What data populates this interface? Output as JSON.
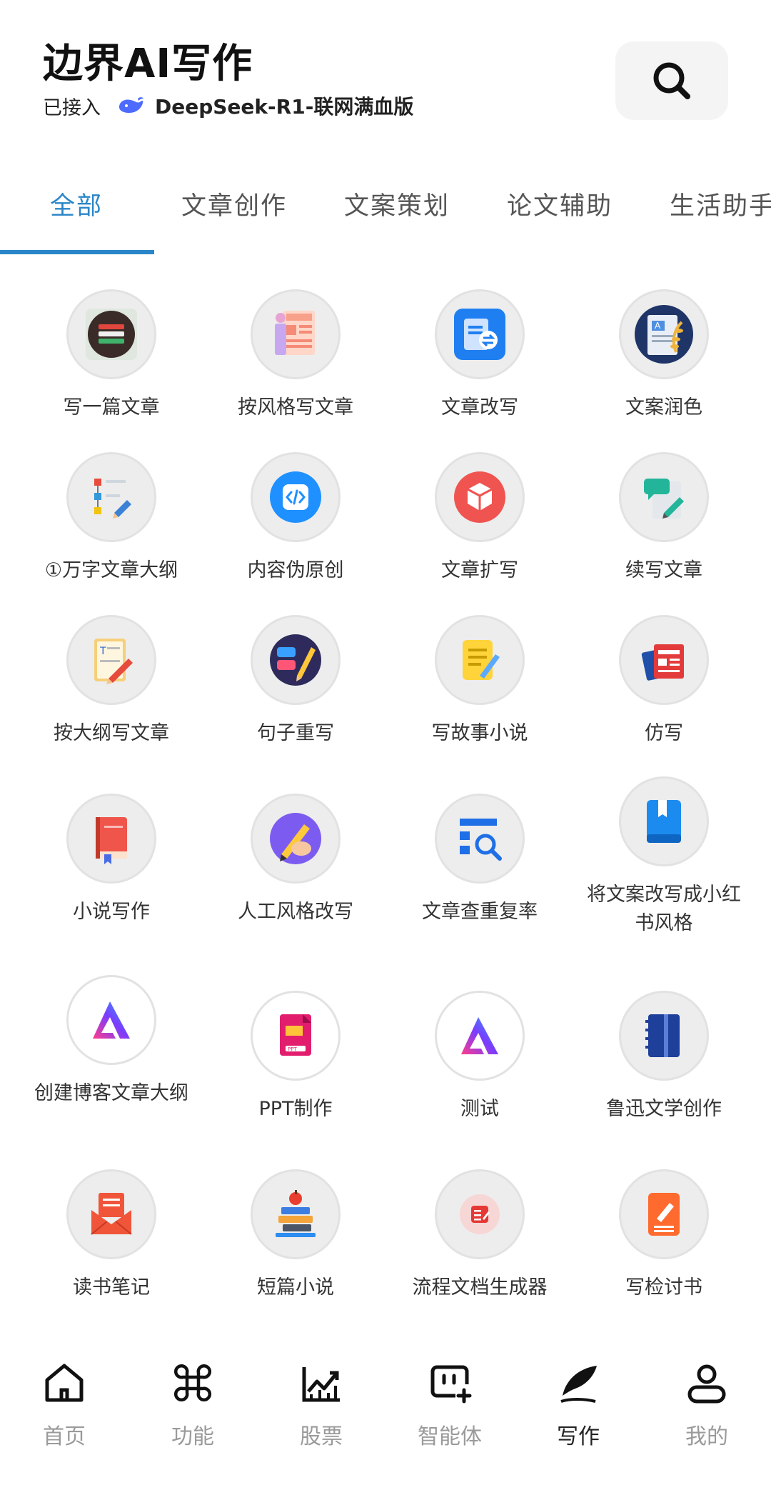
{
  "header": {
    "title": "边界AI写作",
    "model_prefix": "已接入",
    "model_name": "DeepSeek-R1-联网满血版"
  },
  "tabs": [
    {
      "label": "全部",
      "active": true
    },
    {
      "label": "文章创作"
    },
    {
      "label": "文案策划"
    },
    {
      "label": "论文辅助"
    },
    {
      "label": "生活助手"
    }
  ],
  "tools": [
    {
      "label": "写一篇文章",
      "icon": "stack-book-icon"
    },
    {
      "label": "按风格写文章",
      "icon": "news-board-icon"
    },
    {
      "label": "文章改写",
      "icon": "doc-exchange-icon"
    },
    {
      "label": "文案润色",
      "icon": "laurel-doc-icon"
    },
    {
      "label": "①万字文章大纲",
      "icon": "flowchart-pencil-icon"
    },
    {
      "label": "内容伪原创",
      "icon": "code-tag-icon"
    },
    {
      "label": "文章扩写",
      "icon": "cube-icon"
    },
    {
      "label": "续写文章",
      "icon": "chat-doc-pencil-icon"
    },
    {
      "label": "按大纲写文章",
      "icon": "notepad-pencil-icon"
    },
    {
      "label": "句子重写",
      "icon": "chat-bubbles-pencil-icon"
    },
    {
      "label": "写故事小说",
      "icon": "yellow-notes-icon"
    },
    {
      "label": "仿写",
      "icon": "newspapers-icon"
    },
    {
      "label": "小说写作",
      "icon": "red-book-icon"
    },
    {
      "label": "人工风格改写",
      "icon": "hand-pencil-icon"
    },
    {
      "label": "文章查重复率",
      "icon": "doc-search-icon"
    },
    {
      "label": "将文案改写成小红书风格",
      "icon": "blue-book-icon"
    },
    {
      "label": "创建博客文章大纲",
      "icon": "gradient-a-logo-icon"
    },
    {
      "label": "PPT制作",
      "icon": "ppt-file-icon"
    },
    {
      "label": "测试",
      "icon": "gradient-a-logo-icon"
    },
    {
      "label": "鲁迅文学创作",
      "icon": "notebook-icon"
    },
    {
      "label": "读书笔记",
      "icon": "envelope-letter-icon"
    },
    {
      "label": "短篇小说",
      "icon": "books-apple-icon"
    },
    {
      "label": "流程文档生成器",
      "icon": "red-notes-icon"
    },
    {
      "label": "写检讨书",
      "icon": "orange-doc-pencil-icon"
    }
  ],
  "bottom_nav": [
    {
      "label": "首页",
      "icon": "home-icon"
    },
    {
      "label": "功能",
      "icon": "command-icon"
    },
    {
      "label": "股票",
      "icon": "stock-chart-icon"
    },
    {
      "label": "智能体",
      "icon": "agent-icon"
    },
    {
      "label": "写作",
      "icon": "quill-icon",
      "active": true
    },
    {
      "label": "我的",
      "icon": "user-icon"
    }
  ],
  "colors": {
    "accent": "#2a86c8",
    "inactive_nav": "#9a9a9a",
    "icon_bg": "#ededed"
  }
}
